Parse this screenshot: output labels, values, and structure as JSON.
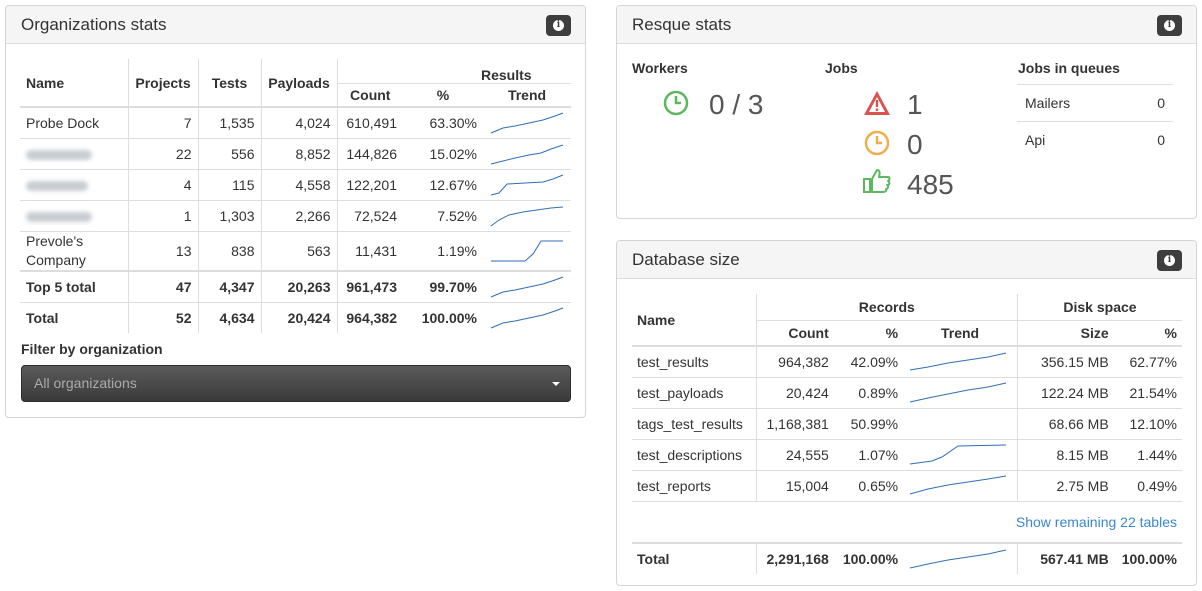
{
  "org": {
    "title": "Organizations stats",
    "headers": {
      "name": "Name",
      "projects": "Projects",
      "tests": "Tests",
      "payloads": "Payloads",
      "results": "Results",
      "count": "Count",
      "pct": "%",
      "trend": "Trend"
    },
    "rows": [
      {
        "name": "Probe Dock",
        "projects": "7",
        "tests": "1,535",
        "payloads": "4,024",
        "count": "610,491",
        "pct": "63.30%"
      },
      {
        "name": "",
        "projects": "22",
        "tests": "556",
        "payloads": "8,852",
        "count": "144,826",
        "pct": "15.02%"
      },
      {
        "name": "",
        "projects": "4",
        "tests": "115",
        "payloads": "4,558",
        "count": "122,201",
        "pct": "12.67%"
      },
      {
        "name": "",
        "projects": "1",
        "tests": "1,303",
        "payloads": "2,266",
        "count": "72,524",
        "pct": "7.52%"
      },
      {
        "name": "Prevole's Company",
        "projects": "13",
        "tests": "838",
        "payloads": "563",
        "count": "11,431",
        "pct": "1.19%"
      },
      {
        "name": "Top 5 total",
        "projects": "47",
        "tests": "4,347",
        "payloads": "20,263",
        "count": "961,473",
        "pct": "99.70%"
      },
      {
        "name": "Total",
        "projects": "52",
        "tests": "4,634",
        "payloads": "20,424",
        "count": "964,382",
        "pct": "100.00%"
      }
    ],
    "filter_label": "Filter by organization",
    "filter_value": "All organizations"
  },
  "resque": {
    "title": "Resque stats",
    "workers_label": "Workers",
    "workers_value": "0 / 3",
    "jobs_label": "Jobs",
    "jobs_failed": "1",
    "jobs_pending": "0",
    "jobs_processed": "485",
    "queues_label": "Jobs in queues",
    "queues": [
      {
        "name": "Mailers",
        "count": "0"
      },
      {
        "name": "Api",
        "count": "0"
      }
    ]
  },
  "db": {
    "title": "Database size",
    "headers": {
      "name": "Name",
      "records": "Records",
      "disk": "Disk space",
      "count": "Count",
      "pct": "%",
      "trend": "Trend",
      "size": "Size",
      "size_pct": "%"
    },
    "rows": [
      {
        "name": "test_results",
        "count": "964,382",
        "pct": "42.09%",
        "size": "356.15 MB",
        "size_pct": "62.77%"
      },
      {
        "name": "test_payloads",
        "count": "20,424",
        "pct": "0.89%",
        "size": "122.24 MB",
        "size_pct": "21.54%"
      },
      {
        "name": "tags_test_results",
        "count": "1,168,381",
        "pct": "50.99%",
        "size": "68.66 MB",
        "size_pct": "12.10%"
      },
      {
        "name": "test_descriptions",
        "count": "24,555",
        "pct": "1.07%",
        "size": "8.15 MB",
        "size_pct": "1.44%"
      },
      {
        "name": "test_reports",
        "count": "15,004",
        "pct": "0.65%",
        "size": "2.75 MB",
        "size_pct": "0.49%"
      }
    ],
    "show_remaining": "Show remaining 22 tables",
    "total": {
      "name": "Total",
      "count": "2,291,168",
      "pct": "100.00%",
      "size": "567.41 MB",
      "size_pct": "100.00%"
    }
  },
  "colors": {
    "spark": "#2f6fb5",
    "green": "#5cb85c",
    "orange": "#f0ad4e",
    "red": "#d9534f"
  }
}
